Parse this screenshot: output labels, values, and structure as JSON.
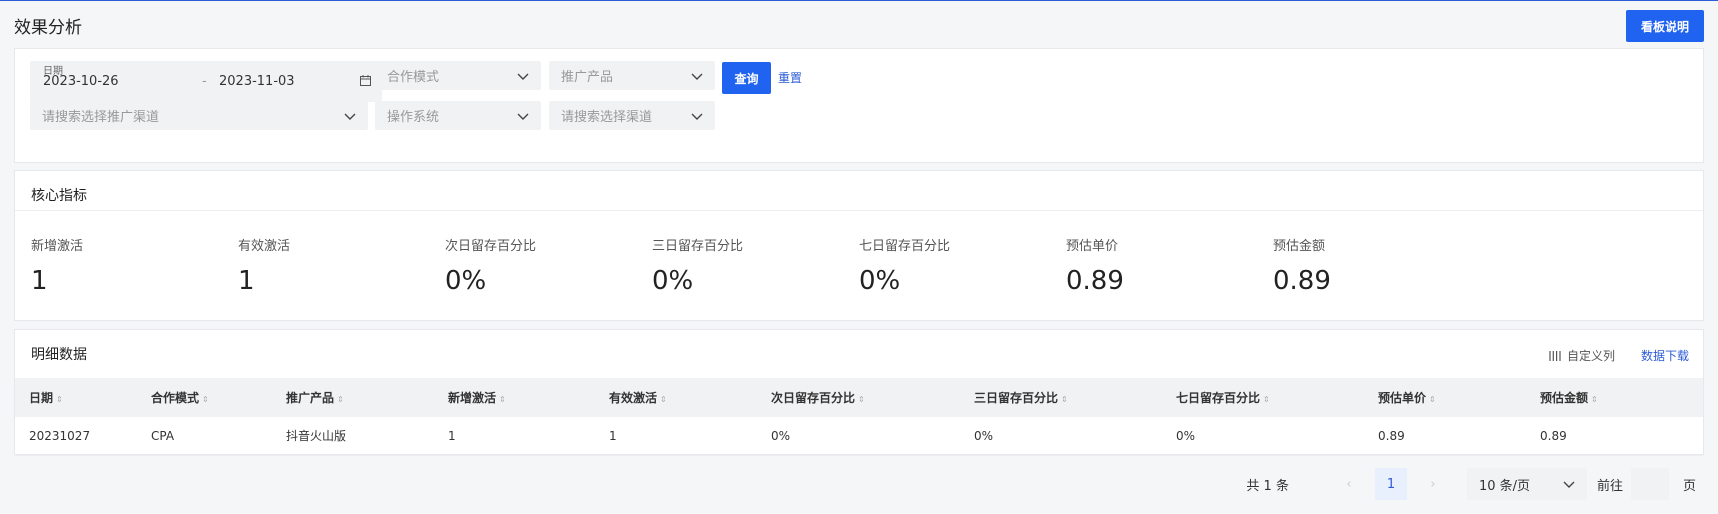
{
  "header": {
    "title": "效果分析",
    "board_button": "看板说明"
  },
  "filters": {
    "date_label": "日期",
    "date_start": "2023-10-26",
    "date_separator": "-",
    "date_end": "2023-11-03",
    "coop_mode_placeholder": "合作模式",
    "product_placeholder": "推广产品",
    "query_button": "查询",
    "reset_link": "重置",
    "channel_search_placeholder": "请搜索选择推广渠道",
    "os_placeholder": "操作系统",
    "subchannel_placeholder": "请搜索选择渠道"
  },
  "metrics": {
    "title": "核心指标",
    "items": [
      {
        "label": "新增激活",
        "value": "1"
      },
      {
        "label": "有效激活",
        "value": "1"
      },
      {
        "label": "次日留存百分比",
        "value": "0%"
      },
      {
        "label": "三日留存百分比",
        "value": "0%"
      },
      {
        "label": "七日留存百分比",
        "value": "0%"
      },
      {
        "label": "预估单价",
        "value": "0.89"
      },
      {
        "label": "预估金额",
        "value": "0.89"
      }
    ]
  },
  "detail": {
    "title": "明细数据",
    "custom_columns": "自定义列",
    "download": "数据下载",
    "columns": [
      "日期",
      "合作模式",
      "推广产品",
      "新增激活",
      "有效激活",
      "次日留存百分比",
      "三日留存百分比",
      "七日留存百分比",
      "预估单价",
      "预估金额"
    ],
    "rows": [
      [
        "20231027",
        "CPA",
        "抖音火山版",
        "1",
        "1",
        "0%",
        "0%",
        "0%",
        "0.89",
        "0.89"
      ]
    ]
  },
  "pagination": {
    "total": "共 1 条",
    "prev": "‹",
    "current": "1",
    "next": "›",
    "page_size": "10 条/页",
    "goto": "前往",
    "page_suffix": "页"
  },
  "colors": {
    "primary": "#1f63f0",
    "link": "#2b5bd7",
    "background": "#f5f6f8",
    "field_bg": "#f1f2f4"
  }
}
